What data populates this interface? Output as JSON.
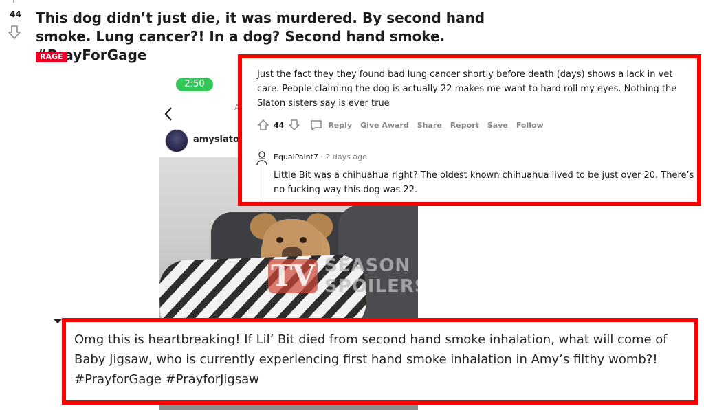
{
  "post": {
    "score": "44",
    "title": "This dog didn’t just die, it was murdered. By second hand smoke. Lung cancer?! In a dog? Second hand smoke. #PrayForGage",
    "flair": "RAGE"
  },
  "instagram": {
    "timer": "2:50",
    "username": "amyslaton",
    "header_fragment": "A",
    "watermark": {
      "logo": "TV",
      "text_line1": "SEASON",
      "text_line2": "SPOILERS"
    }
  },
  "top_comment": {
    "text": "Just the fact they they found bad lung cancer shortly before death (days) shows a lack in vet care. People claiming the dog is actually 22 makes me want to hard roll my eyes. Nothing the Slaton sisters say is ever true",
    "score": "44",
    "actions": {
      "reply": "Reply",
      "give_award": "Give Award",
      "share": "Share",
      "report": "Report",
      "save": "Save",
      "follow": "Follow"
    },
    "reply": {
      "username": "EqualPaint7",
      "time": "· 2 days ago",
      "text": "Little Bit was a chihuahua right? The oldest known chihuahua lived to be just over 20. There’s no fucking way this dog was 22."
    }
  },
  "bottom_comment": {
    "text": "Omg this is heartbreaking! If Lil’ Bit died from second hand smoke inhalation, what will come of Baby Jigsaw, who is currently experiencing first hand smoke inhalation in Amy’s filthy womb?! #PrayforGage #PrayforJigsaw"
  },
  "colors": {
    "highlight_border": "#ff0000",
    "flair_bg": "#ea0027",
    "timer_bg": "#34c759",
    "action_gray": "#878a8c"
  }
}
